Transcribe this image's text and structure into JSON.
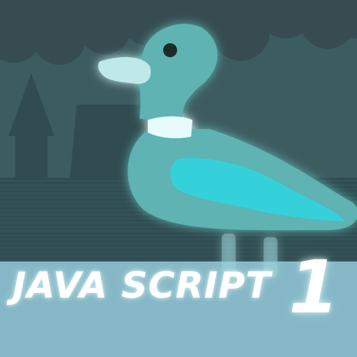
{
  "thumbnail": {
    "title": "JAVA SCRIPT",
    "number": "1",
    "character": "ghost-duck",
    "colors": {
      "sky": "#3d5c60",
      "wall": "#2e4a4f",
      "water": "#86b7c6",
      "duck_body": "#5fb3b3",
      "duck_wing": "#35d1da",
      "cloud": "#364c50"
    }
  }
}
